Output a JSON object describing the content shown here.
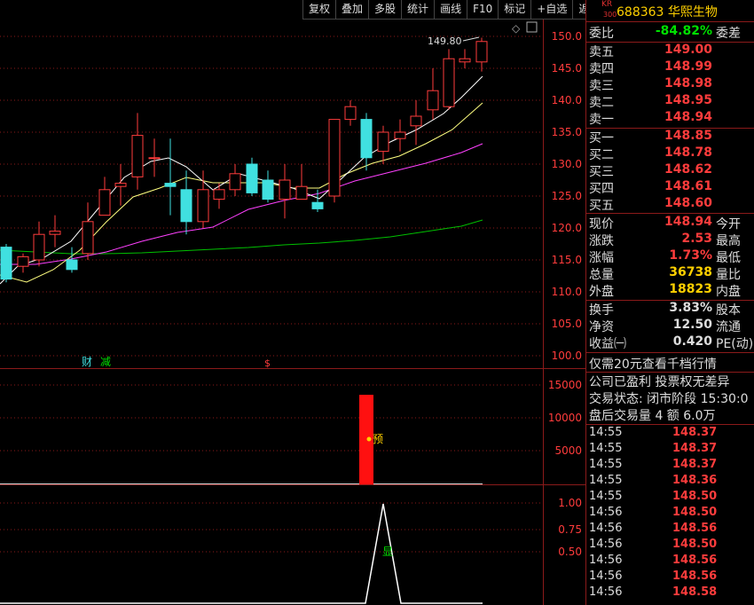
{
  "toolbar": {
    "items": [
      "复权",
      "叠加",
      "多股",
      "统计",
      "画线",
      "F10",
      "标记",
      "+自选",
      "返回"
    ]
  },
  "header": {
    "board_badge_top": "KR",
    "board_badge_bottom": "300",
    "code_name": "688363 华熙生物"
  },
  "order_ratio": {
    "label": "委比",
    "value": "-84.82%",
    "right": "委差"
  },
  "asks": [
    {
      "label": "卖五",
      "price": "149.00"
    },
    {
      "label": "卖四",
      "price": "148.99"
    },
    {
      "label": "卖三",
      "price": "148.98"
    },
    {
      "label": "卖二",
      "price": "148.95"
    },
    {
      "label": "卖一",
      "price": "148.94"
    }
  ],
  "bids": [
    {
      "label": "买一",
      "price": "148.85"
    },
    {
      "label": "买二",
      "price": "148.78"
    },
    {
      "label": "买三",
      "price": "148.62"
    },
    {
      "label": "买四",
      "price": "148.61"
    },
    {
      "label": "买五",
      "price": "148.60"
    }
  ],
  "quote": [
    {
      "label": "现价",
      "value": "148.94",
      "right": "今开",
      "color": "red"
    },
    {
      "label": "涨跌",
      "value": "2.53",
      "right": "最高",
      "color": "red"
    },
    {
      "label": "涨幅",
      "value": "1.73%",
      "right": "最低",
      "color": "red"
    },
    {
      "label": "总量",
      "value": "36738",
      "right": "量比",
      "color": "yellow"
    },
    {
      "label": "外盘",
      "value": "18823",
      "right": "内盘",
      "color": "yellow"
    }
  ],
  "stats": [
    {
      "label": "换手",
      "value": "3.83%",
      "right": "股本"
    },
    {
      "label": "净资",
      "value": "12.50",
      "right": "流通"
    },
    {
      "label": "收益㈠",
      "value": "0.420",
      "right": "PE(动)"
    }
  ],
  "notices": {
    "line1": "仅需20元查看千档行情",
    "line2": "公司已盈利 投票权无差异",
    "line3": "交易状态: 闭市阶段 15:30:0",
    "line4": "盘后交易量 4 额 6.0万"
  },
  "ticks": [
    {
      "time": "14:55",
      "price": "148.37"
    },
    {
      "time": "14:55",
      "price": "148.37"
    },
    {
      "time": "14:55",
      "price": "148.37"
    },
    {
      "time": "14:55",
      "price": "148.36"
    },
    {
      "time": "14:55",
      "price": "148.50"
    },
    {
      "time": "14:56",
      "price": "148.50"
    },
    {
      "time": "14:56",
      "price": "148.56"
    },
    {
      "time": "14:56",
      "price": "148.50"
    },
    {
      "time": "14:56",
      "price": "148.56"
    },
    {
      "time": "14:56",
      "price": "148.56"
    },
    {
      "time": "14:56",
      "price": "148.58"
    }
  ],
  "main_chart": {
    "price_axis": [
      "150.0",
      "145.0",
      "140.0",
      "135.0",
      "130.0",
      "125.0",
      "120.0",
      "115.0",
      "110.0",
      "105.0",
      "100.0"
    ],
    "high_label": "149.80",
    "markers": {
      "cai": "财",
      "jian": "减",
      "dollar": "$"
    }
  },
  "volume_chart": {
    "axis": [
      "15000",
      "10000",
      "5000"
    ],
    "label": "预"
  },
  "indicator_chart": {
    "axis": [
      "1.00",
      "0.75",
      "0.50"
    ],
    "label": "显"
  },
  "colors": {
    "up": "#ff3c3c",
    "down": "#40e0e0",
    "ma5": "#ffffff",
    "ma10": "#ffff80",
    "ma20": "#ff40ff",
    "ma60": "#00c000",
    "grid": "#8b1a1a"
  }
}
